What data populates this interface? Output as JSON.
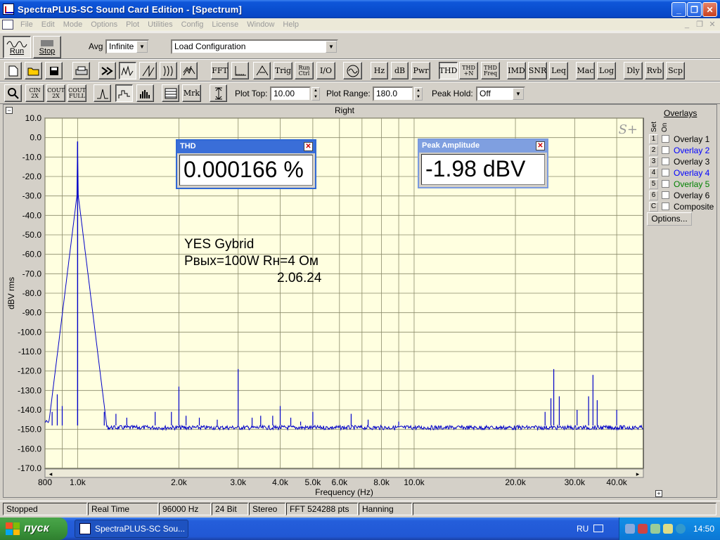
{
  "window": {
    "title": "SpectraPLUS-SC Sound Card Edition - [Spectrum]",
    "minimize": "_",
    "restore": "❐",
    "close": "✕"
  },
  "menu": [
    "File",
    "Edit",
    "Mode",
    "Options",
    "Plot",
    "Utilities",
    "Config",
    "License",
    "Window",
    "Help"
  ],
  "toolbar1": {
    "run": "Run",
    "stop": "Stop",
    "avg_label": "Avg",
    "avg_value": "Infinite",
    "config_value": "Load Configuration"
  },
  "toolbar2": {
    "fft": "FFT",
    "trig": "Trig",
    "run_ctrl_1": "Run",
    "run_ctrl_2": "Ctrl",
    "io": "I/O",
    "hz": "Hz",
    "db": "dB",
    "pwr": "Pwr",
    "thd": "THD",
    "thdn_1": "THD",
    "thdn_2": "+N",
    "thdfreq_1": "THD",
    "thdfreq_2": "Freq",
    "imd": "IMD",
    "snr": "SNR",
    "leq": "Leq",
    "mac": "Mac",
    "log": "Log",
    "dly": "Dly",
    "rvb": "Rvb",
    "scp": "Scp"
  },
  "toolbar3": {
    "cin": "CIN 2X",
    "cout": "COUT 2X",
    "cout_full": "COUT FULL",
    "mrk": "Mrk",
    "plot_top_label": "Plot Top:",
    "plot_top_value": "10.00",
    "plot_range_label": "Plot Range:",
    "plot_range_value": "180.0",
    "peak_hold_label": "Peak Hold:",
    "peak_hold_value": "Off"
  },
  "plot": {
    "title": "Right",
    "badge": "S+"
  },
  "chart_data": {
    "type": "line",
    "title": "Right",
    "xlabel": "Frequency (Hz)",
    "ylabel": "dBV rms",
    "x_scale": "log",
    "xlim": [
      800,
      48000
    ],
    "ylim": [
      -170,
      10
    ],
    "x_ticks": [
      {
        "v": 800,
        "l": "800"
      },
      {
        "v": 1000,
        "l": "1.0k"
      },
      {
        "v": 2000,
        "l": "2.0k"
      },
      {
        "v": 3000,
        "l": "3.0k"
      },
      {
        "v": 4000,
        "l": "4.0k"
      },
      {
        "v": 5000,
        "l": "5.0k"
      },
      {
        "v": 6000,
        "l": "6.0k"
      },
      {
        "v": 8000,
        "l": "8.0k"
      },
      {
        "v": 10000,
        "l": "10.0k"
      },
      {
        "v": 20000,
        "l": "20.0k"
      },
      {
        "v": 30000,
        "l": "30.0k"
      },
      {
        "v": 40000,
        "l": "40.0k"
      }
    ],
    "x_minor": [
      900,
      7000,
      9000
    ],
    "y_ticks": [
      "10.0",
      "0.0",
      "-10.0",
      "-20.0",
      "-30.0",
      "-40.0",
      "-50.0",
      "-60.0",
      "-70.0",
      "-80.0",
      "-90.0",
      "-100.0",
      "-110.0",
      "-120.0",
      "-130.0",
      "-140.0",
      "-150.0",
      "-160.0",
      "-170.0"
    ],
    "grid": true,
    "noise_floor": -148,
    "fundamental": {
      "x": 1000,
      "y": -2
    },
    "peaks": [
      {
        "x": 840,
        "y": -141
      },
      {
        "x": 870,
        "y": -132
      },
      {
        "x": 900,
        "y": -138
      },
      {
        "x": 1200,
        "y": -141
      },
      {
        "x": 1300,
        "y": -142
      },
      {
        "x": 1400,
        "y": -144
      },
      {
        "x": 1700,
        "y": -141
      },
      {
        "x": 1900,
        "y": -141
      },
      {
        "x": 2000,
        "y": -128
      },
      {
        "x": 2100,
        "y": -143
      },
      {
        "x": 2300,
        "y": -144
      },
      {
        "x": 2600,
        "y": -145
      },
      {
        "x": 3000,
        "y": -119
      },
      {
        "x": 3300,
        "y": -144
      },
      {
        "x": 3500,
        "y": -143
      },
      {
        "x": 3800,
        "y": -143
      },
      {
        "x": 4000,
        "y": -138
      },
      {
        "x": 4300,
        "y": -144
      },
      {
        "x": 4600,
        "y": -146
      },
      {
        "x": 5000,
        "y": -141
      },
      {
        "x": 6500,
        "y": -142
      },
      {
        "x": 7300,
        "y": -145
      },
      {
        "x": 9000,
        "y": -146
      },
      {
        "x": 24500,
        "y": -141
      },
      {
        "x": 25500,
        "y": -134
      },
      {
        "x": 26000,
        "y": -119
      },
      {
        "x": 27000,
        "y": -133
      },
      {
        "x": 30500,
        "y": -140
      },
      {
        "x": 33000,
        "y": -133
      },
      {
        "x": 34000,
        "y": -122
      },
      {
        "x": 35000,
        "y": -135
      },
      {
        "x": 40000,
        "y": -140
      }
    ]
  },
  "thd_window": {
    "title": "THD",
    "value": "0.000166 %",
    "close": "✕"
  },
  "peak_window": {
    "title": "Peak Amplitude",
    "value": "-1.98 dBV",
    "close": "✕"
  },
  "annotation": {
    "line1": "YES Gybrid",
    "line2": "Рвых=100W   Rн=4 Ом",
    "line3": "2.06.24"
  },
  "overlays": {
    "title": "Overlays",
    "set_label": "Set",
    "on_label": "On",
    "items": [
      {
        "set": "1",
        "label": "Overlay 1",
        "color": "#000000"
      },
      {
        "set": "2",
        "label": "Overlay 2",
        "color": "#0000ff"
      },
      {
        "set": "3",
        "label": "Overlay 3",
        "color": "#000000"
      },
      {
        "set": "4",
        "label": "Overlay 4",
        "color": "#0000ff"
      },
      {
        "set": "5",
        "label": "Overlay 5",
        "color": "#008000"
      },
      {
        "set": "6",
        "label": "Overlay 6",
        "color": "#000000"
      },
      {
        "set": "C",
        "label": "Composite",
        "color": "#000000"
      }
    ],
    "options_label": "Options..."
  },
  "status": {
    "state": "Stopped",
    "mode": "Real Time",
    "rate": "96000 Hz",
    "bits": "24 Bit",
    "channels": "Stereo",
    "fft": "FFT 524288 pts",
    "window": "Hanning"
  },
  "taskbar": {
    "start": "пуск",
    "task": "SpectraPLUS-SC Sou...",
    "lang": "RU",
    "time": "14:50"
  },
  "colors": {
    "plot_bg": "#ffffe0",
    "trace": "#0000c8",
    "titlebar": "#0a4fd0",
    "float_title": "#3a6ed8"
  }
}
